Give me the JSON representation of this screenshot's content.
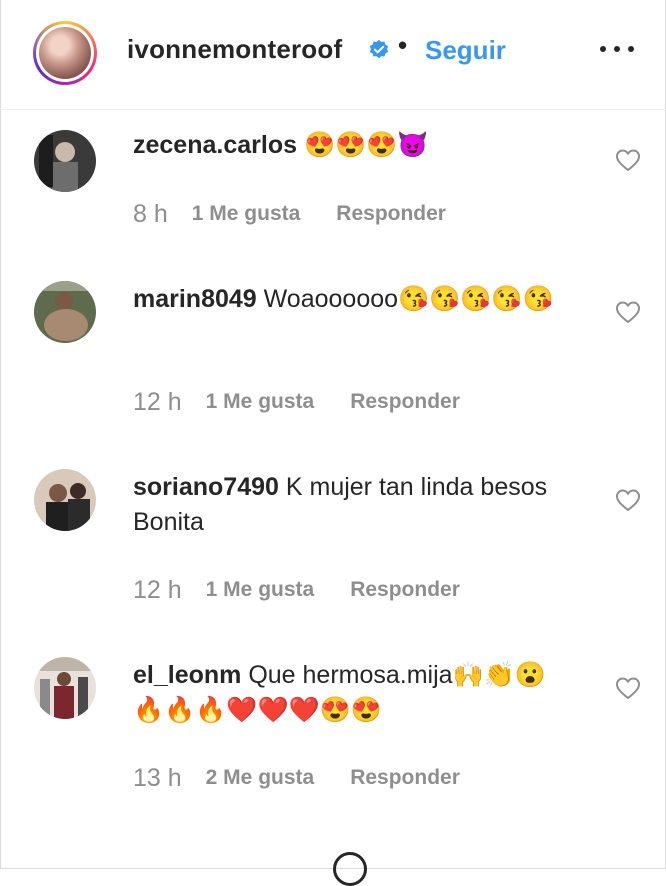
{
  "header": {
    "username": "ivonnemonteroof",
    "separator": "•",
    "follow_label": "Seguir"
  },
  "comments": [
    {
      "user": "zecena.carlos",
      "text": " 😍😍😍😈",
      "time": "8 h",
      "likes": "1 Me gusta",
      "reply": "Responder"
    },
    {
      "user": "marin8049",
      "text": " Woaoooooo😘😘😘😘😘",
      "time": "12 h",
      "likes": "1 Me gusta",
      "reply": "Responder"
    },
    {
      "user": "soriano7490",
      "text": " K mujer tan linda besos Bonita",
      "time": "12 h",
      "likes": "1 Me gusta",
      "reply": "Responder"
    },
    {
      "user": "el_leonm",
      "text": " Que hermosa.mija🙌👏😮🔥🔥🔥❤️❤️❤️😍😍",
      "time": "13 h",
      "likes": "2 Me gusta",
      "reply": "Responder"
    }
  ],
  "colors": {
    "link": "#3897f0",
    "text": "#262626",
    "secondary": "#8e8e8e"
  }
}
